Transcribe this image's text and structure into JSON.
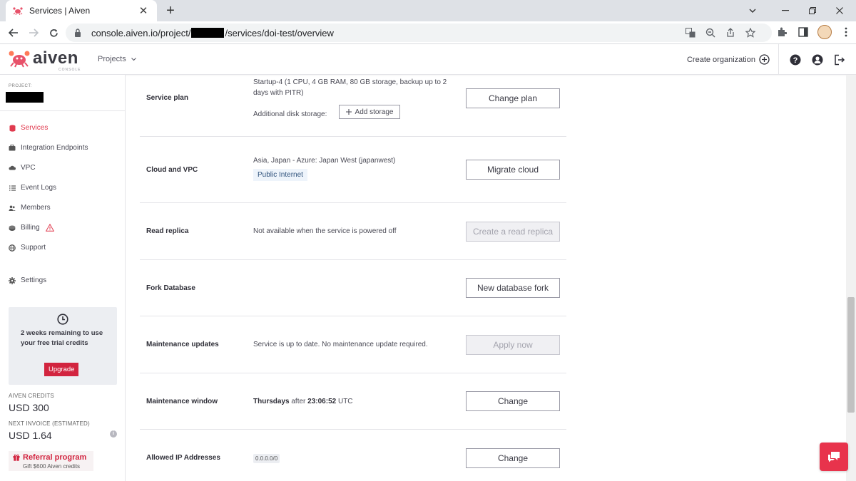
{
  "browser": {
    "tab_title": "Services | Aiven",
    "url_prefix": "console.aiven.io/project/",
    "url_suffix": "/services/doi-test/overview",
    "tab_close": "✕",
    "new_tab": "+"
  },
  "header": {
    "logo_text": "aiven",
    "logo_sub": "CONSOLE",
    "projects_label": "Projects",
    "create_org_label": "Create organization"
  },
  "sidebar": {
    "project_label": "PROJECT:",
    "items": [
      {
        "label": "Services",
        "icon": "database-icon",
        "active": true
      },
      {
        "label": "Integration Endpoints",
        "icon": "endpoint-icon"
      },
      {
        "label": "VPC",
        "icon": "cloud-icon"
      },
      {
        "label": "Event Logs",
        "icon": "list-icon"
      },
      {
        "label": "Members",
        "icon": "members-icon"
      },
      {
        "label": "Billing",
        "icon": "billing-icon"
      },
      {
        "label": "Support",
        "icon": "globe-icon"
      },
      {
        "label": "Settings",
        "icon": "gear-icon"
      }
    ],
    "trial_text": "2 weeks remaining to use your free trial credits",
    "upgrade_label": "Upgrade",
    "credits_label": "AIVEN CREDITS",
    "credits_value": "USD 300",
    "invoice_label": "NEXT INVOICE (ESTIMATED)",
    "invoice_value": "USD 1.64",
    "referral_title": "Referral program",
    "referral_sub": "Gift $600 Aiven credits"
  },
  "main": {
    "rows": [
      {
        "label": "Service plan",
        "desc": "Startup-4 (1 CPU, 4 GB RAM, 80 GB storage, backup up to 2 days with PITR)",
        "extra_label": "Additional disk storage:",
        "extra_button": "Add storage",
        "button": "Change plan"
      },
      {
        "label": "Cloud and VPC",
        "desc": "Asia, Japan - Azure: Japan West (japanwest)",
        "tag": "Public Internet",
        "button": "Migrate cloud"
      },
      {
        "label": "Read replica",
        "desc": "Not available when the service is powered off",
        "button": "Create a read replica"
      },
      {
        "label": "Fork Database",
        "button": "New database fork"
      },
      {
        "label": "Maintenance updates",
        "desc": "Service is up to date. No maintenance update required.",
        "button": "Apply now"
      },
      {
        "label": "Maintenance window",
        "day": "Thursdays",
        "after": "after",
        "time": "23:06:52",
        "tz": "UTC",
        "button": "Change"
      },
      {
        "label": "Allowed IP Addresses",
        "tag": "0.0.0.0/0",
        "button": "Change"
      }
    ]
  },
  "colors": {
    "accent": "#e03a4e",
    "upgrade": "#d2243f"
  }
}
